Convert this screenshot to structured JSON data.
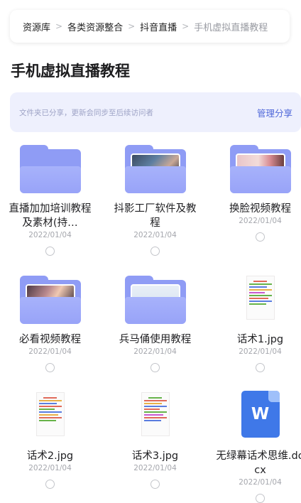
{
  "breadcrumb": {
    "items": [
      "资源库",
      "各类资源整合",
      "抖音直播",
      "手机虚拟直播教程"
    ],
    "separator": ">"
  },
  "page": {
    "title": "手机虚拟直播教程"
  },
  "share": {
    "note": "文件夹已分享，更新会同步至后续访问者",
    "manage_label": "管理分享"
  },
  "files": [
    {
      "name": "直播加加培训教程及素材(持…",
      "date": "2022/01/04",
      "type": "folder-icon"
    },
    {
      "name": "抖影工厂软件及教程",
      "date": "2022/01/04",
      "type": "folder-icon"
    },
    {
      "name": "换脸视频教程",
      "date": "2022/01/04",
      "type": "folder-icon"
    },
    {
      "name": "必看视频教程",
      "date": "2022/01/04",
      "type": "folder-icon"
    },
    {
      "name": "兵马俑使用教程",
      "date": "2022/01/04",
      "type": "folder-icon"
    },
    {
      "name": "话术1.jpg",
      "date": "2022/01/04",
      "type": "image-file-icon"
    },
    {
      "name": "话术2.jpg",
      "date": "2022/01/04",
      "type": "image-file-icon"
    },
    {
      "name": "话术3.jpg",
      "date": "2022/01/04",
      "type": "image-file-icon"
    },
    {
      "name": "无绿幕话术思维.docx",
      "date": "2022/01/04",
      "type": "word-doc-icon"
    }
  ],
  "colors": {
    "accent": "#4f67d9",
    "folder": "#98a3f8",
    "word_blue": "#3f78e8"
  }
}
